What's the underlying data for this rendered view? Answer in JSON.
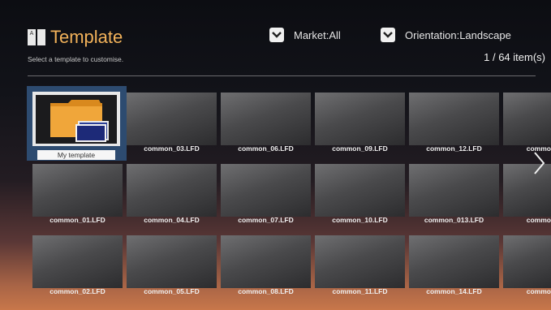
{
  "header": {
    "title": "Template",
    "subtitle": "Select a template to customise.",
    "market_label": "Market:All",
    "orientation_label": "Orientation:Landscape",
    "item_count": "1 / 64 item(s)"
  },
  "colors": {
    "accent": "#f2b25a",
    "focus": "#2d4b70"
  },
  "tiles": {
    "my_template": "My template",
    "c03": "common_03.LFD",
    "c06": "common_06.LFD",
    "c09": "common_09.LFD",
    "c12": "common_12.LFD",
    "c15p": "commo",
    "c01": "common_01.LFD",
    "c04": "common_04.LFD",
    "c07": "common_07.LFD",
    "c10": "common_10.LFD",
    "c013": "common_013.LFD",
    "c16p": "commo",
    "c02": "common_02.LFD",
    "c05": "common_05.LFD",
    "c08": "common_08.LFD",
    "c11": "common_11.LFD",
    "c14": "common_14.LFD",
    "c17p": "commo"
  },
  "icons": {
    "title": "template-icon",
    "dropdown": "chevron-down-icon",
    "folder": "folder-icon",
    "next": "chevron-right-icon"
  }
}
